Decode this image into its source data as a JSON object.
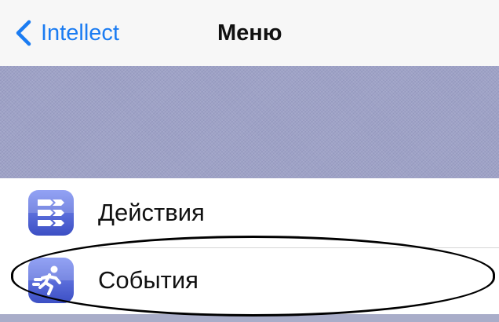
{
  "navbar": {
    "back_label": "Intellect",
    "title": "Меню",
    "back_icon": "chevron-left-icon",
    "accent_color": "#1b7cf2"
  },
  "banner": {
    "color": "#9ea2c6"
  },
  "menu": {
    "items": [
      {
        "label": "Действия",
        "icon": "actions-icon"
      },
      {
        "label": "События",
        "icon": "running-person-icon"
      }
    ]
  },
  "annotation": {
    "highlighted_item": "События",
    "highlight_color": "#000000"
  }
}
